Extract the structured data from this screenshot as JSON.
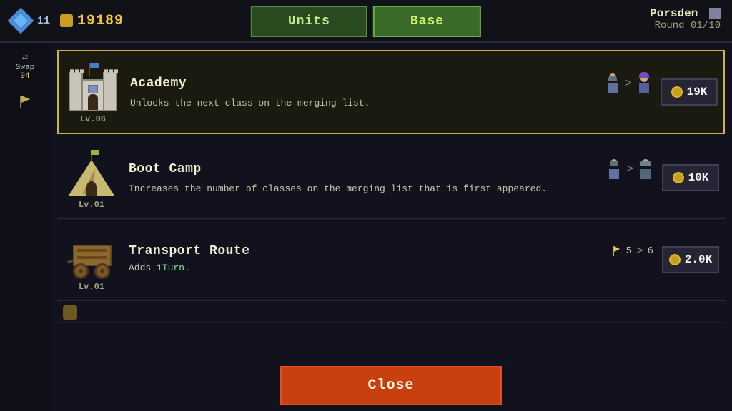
{
  "header": {
    "diamond_level": "11",
    "gold": "19189",
    "tab_units": "Units",
    "tab_base": "Base",
    "location": "Porsden",
    "round": "Round 01/10",
    "swap_label": "Swap",
    "swap_count": "04"
  },
  "items": [
    {
      "id": "academy",
      "name": "Academy",
      "desc": "Unlocks the next class on the merging list.",
      "level": "Lv.06",
      "price": "19K",
      "highlighted": true,
      "upgrade_from": "warrior",
      "upgrade_to": "mage"
    },
    {
      "id": "boot-camp",
      "name": "Boot Camp",
      "desc": "Increases the number of classes on the merging\nlist that is first appeared.",
      "level": "Lv.01",
      "price": "10K",
      "highlighted": false
    },
    {
      "id": "transport-route",
      "name": "Transport Route",
      "desc_prefix": "Adds 1",
      "desc_highlight": "Turn",
      "desc_suffix": ".",
      "level": "Lv.01",
      "price": "2.0K",
      "highlighted": false,
      "flag_count_from": "5",
      "flag_count_to": "6"
    }
  ],
  "close_btn": "Close"
}
